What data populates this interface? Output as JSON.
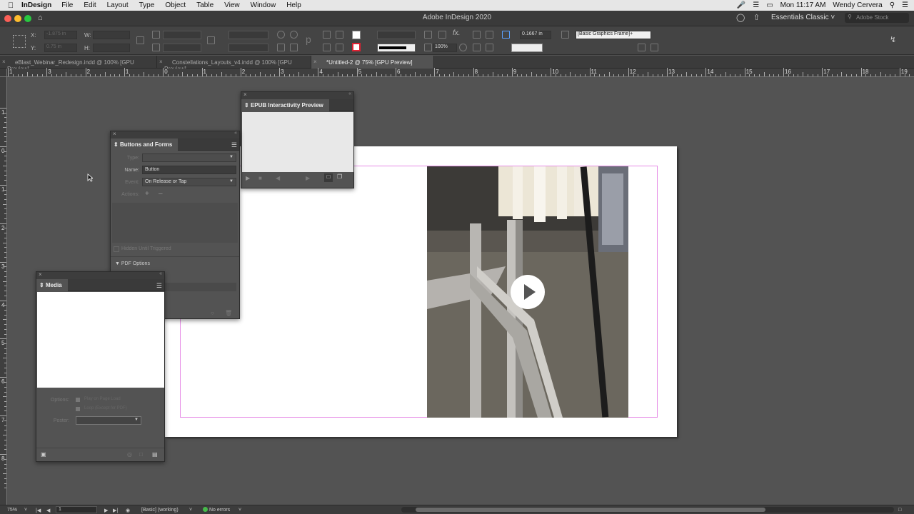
{
  "menubar": {
    "app_name": "InDesign",
    "items": [
      "File",
      "Edit",
      "Layout",
      "Type",
      "Object",
      "Table",
      "View",
      "Window",
      "Help"
    ],
    "clock": "Mon 11:17 AM",
    "user": "Wendy Cervera"
  },
  "titlebar": {
    "title": "Adobe InDesign 2020",
    "workspace": "Essentials Classic",
    "search_placeholder": "Adobe Stock"
  },
  "control": {
    "x_label": "X:",
    "x_value": "-1.875 in",
    "y_label": "Y:",
    "y_value": "0.75 in",
    "w_label": "W:",
    "h_label": "H:",
    "zoom_value": "100%",
    "stroke_weight": "0.1667 in",
    "object_style": "[Basic Graphics Frame]+"
  },
  "tabs": [
    {
      "label": "eBlast_Webinar_Redesign.indd @ 100% [GPU Preview]",
      "active": false
    },
    {
      "label": "Constellations_Layouts_v4.indd @ 100% [GPU Preview]",
      "active": false
    },
    {
      "label": "*Untitled-2 @ 75% [GPU Preview]",
      "active": true
    }
  ],
  "ruler": {
    "h_labels": [
      "1",
      "3",
      "2",
      "1",
      "0",
      "1",
      "2",
      "3",
      "4",
      "5",
      "6",
      "7",
      "8",
      "9",
      "10",
      "11",
      "12",
      "13",
      "14",
      "15",
      "16",
      "17",
      "18",
      "19"
    ],
    "v_labels": [
      "1",
      "0",
      "1",
      "2",
      "3",
      "4",
      "5",
      "6",
      "7",
      "8"
    ]
  },
  "epub_panel": {
    "title": "EPUB Interactivity Preview"
  },
  "buttons_panel": {
    "title": "Buttons and Forms",
    "type_label": "Type:",
    "name_label": "Name:",
    "name_value": "Button",
    "event_label": "Event:",
    "event_value": "On Release or Tap",
    "actions_label": "Actions:",
    "hidden_label": "Hidden Until Triggered",
    "pdf_options": "PDF Options"
  },
  "media_panel": {
    "title": "Media",
    "options_label": "Options:",
    "play_on_load": "Play on Page Load",
    "loop": "Loop (Except for PDF)",
    "poster_label": "Poster:"
  },
  "status": {
    "zoom": "75%",
    "page": "1",
    "preflight_profile": "[Basic] (working)",
    "errors": "No errors"
  },
  "colors": {
    "margin_guide": "#e68ce6",
    "ok_dot": "#46b94a"
  }
}
